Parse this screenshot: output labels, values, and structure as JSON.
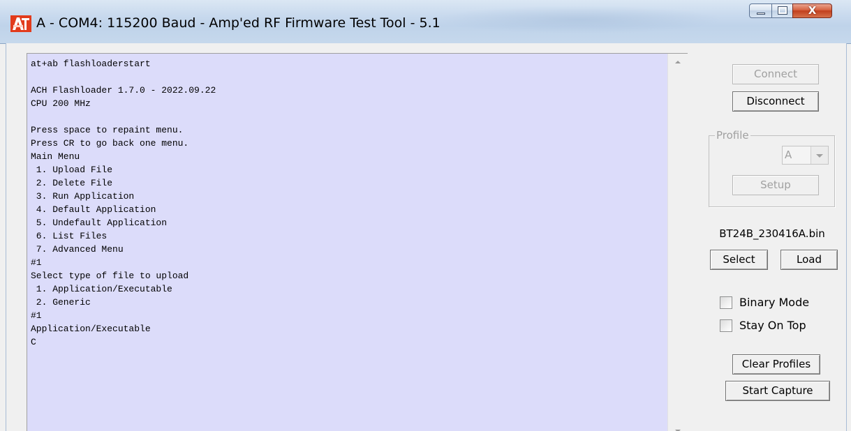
{
  "window": {
    "title": "A - COM4: 115200 Baud - Amp'ed RF Firmware Test Tool - 5.1",
    "app_icon": "amped-rf-icon",
    "close_symbol": "X"
  },
  "terminal": {
    "background_color": "#dcdcfa",
    "text": "at+ab flashloaderstart\n\nACH Flashloader 1.7.0 - 2022.09.22\nCPU 200 MHz\n\nPress space to repaint menu.\nPress CR to go back one menu.\nMain Menu\n 1. Upload File\n 2. Delete File\n 3. Run Application\n 4. Default Application\n 5. Undefault Application\n 6. List Files\n 7. Advanced Menu\n#1\nSelect type of file to upload\n 1. Application/Executable\n 2. Generic\n#1\nApplication/Executable\nC"
  },
  "controls": {
    "connect_label": "Connect",
    "disconnect_label": "Disconnect",
    "profile_legend": "Profile",
    "profile_selected": "A",
    "setup_label": "Setup",
    "file_name": "BT24B_230416A.bin",
    "select_label": "Select",
    "load_label": "Load",
    "binary_mode_label": "Binary Mode",
    "binary_mode_checked": false,
    "stay_on_top_label": "Stay On Top",
    "stay_on_top_checked": false,
    "clear_profiles_label": "Clear Profiles",
    "start_capture_label": "Start Capture"
  }
}
